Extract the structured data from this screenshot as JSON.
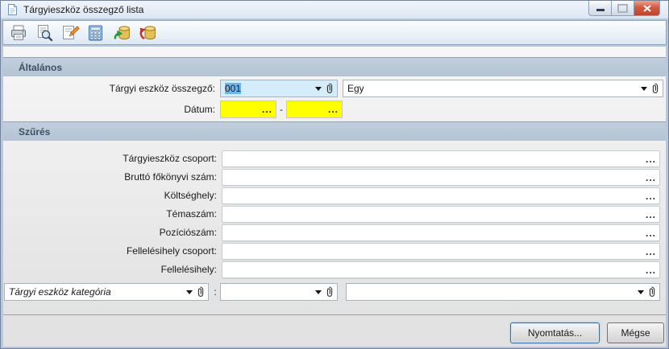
{
  "window": {
    "title": "Tárgyieszköz összegző lista"
  },
  "toolbar": {
    "icons": [
      "print",
      "print-preview",
      "edit",
      "calculator",
      "database-import",
      "database-export"
    ]
  },
  "general": {
    "header": "Általános",
    "asset_summary_label": "Tárgyi eszköz összegző:",
    "asset_summary_code": "001",
    "asset_summary_name": "Egy",
    "date_label": "Dátum:",
    "date_from": "",
    "date_to": "",
    "date_separator": "-",
    "ellipsis": "..."
  },
  "filter": {
    "header": "Szűrés",
    "ellipsis": "...",
    "rows": [
      {
        "label": "Tárgyieszköz csoport:",
        "value": ""
      },
      {
        "label": "Bruttó főkönyvi szám:",
        "value": ""
      },
      {
        "label": "Költséghely:",
        "value": ""
      },
      {
        "label": "Témaszám:",
        "value": ""
      },
      {
        "label": "Pozíciószám:",
        "value": ""
      },
      {
        "label": "Fellelésihely csoport:",
        "value": ""
      },
      {
        "label": "Fellelésihely:",
        "value": ""
      }
    ]
  },
  "category_row": {
    "category_combo_value": "Tárgyi eszköz kategória",
    "separator": ":",
    "value_combo_value": "",
    "detail_combo_value": ""
  },
  "footer": {
    "print_button": "Nyomtatás...",
    "cancel_button": "Mégse"
  },
  "colors": {
    "titlebar_bg": "#e9f0f9",
    "window_border": "#b7c8dc",
    "section_header_bg": "#b9c8d7",
    "date_field_bg": "#ffff00",
    "focused_combo_bg": "#d5ecfb",
    "selection_bg": "#6db7ee",
    "close_button_red": "#cf4a38"
  }
}
